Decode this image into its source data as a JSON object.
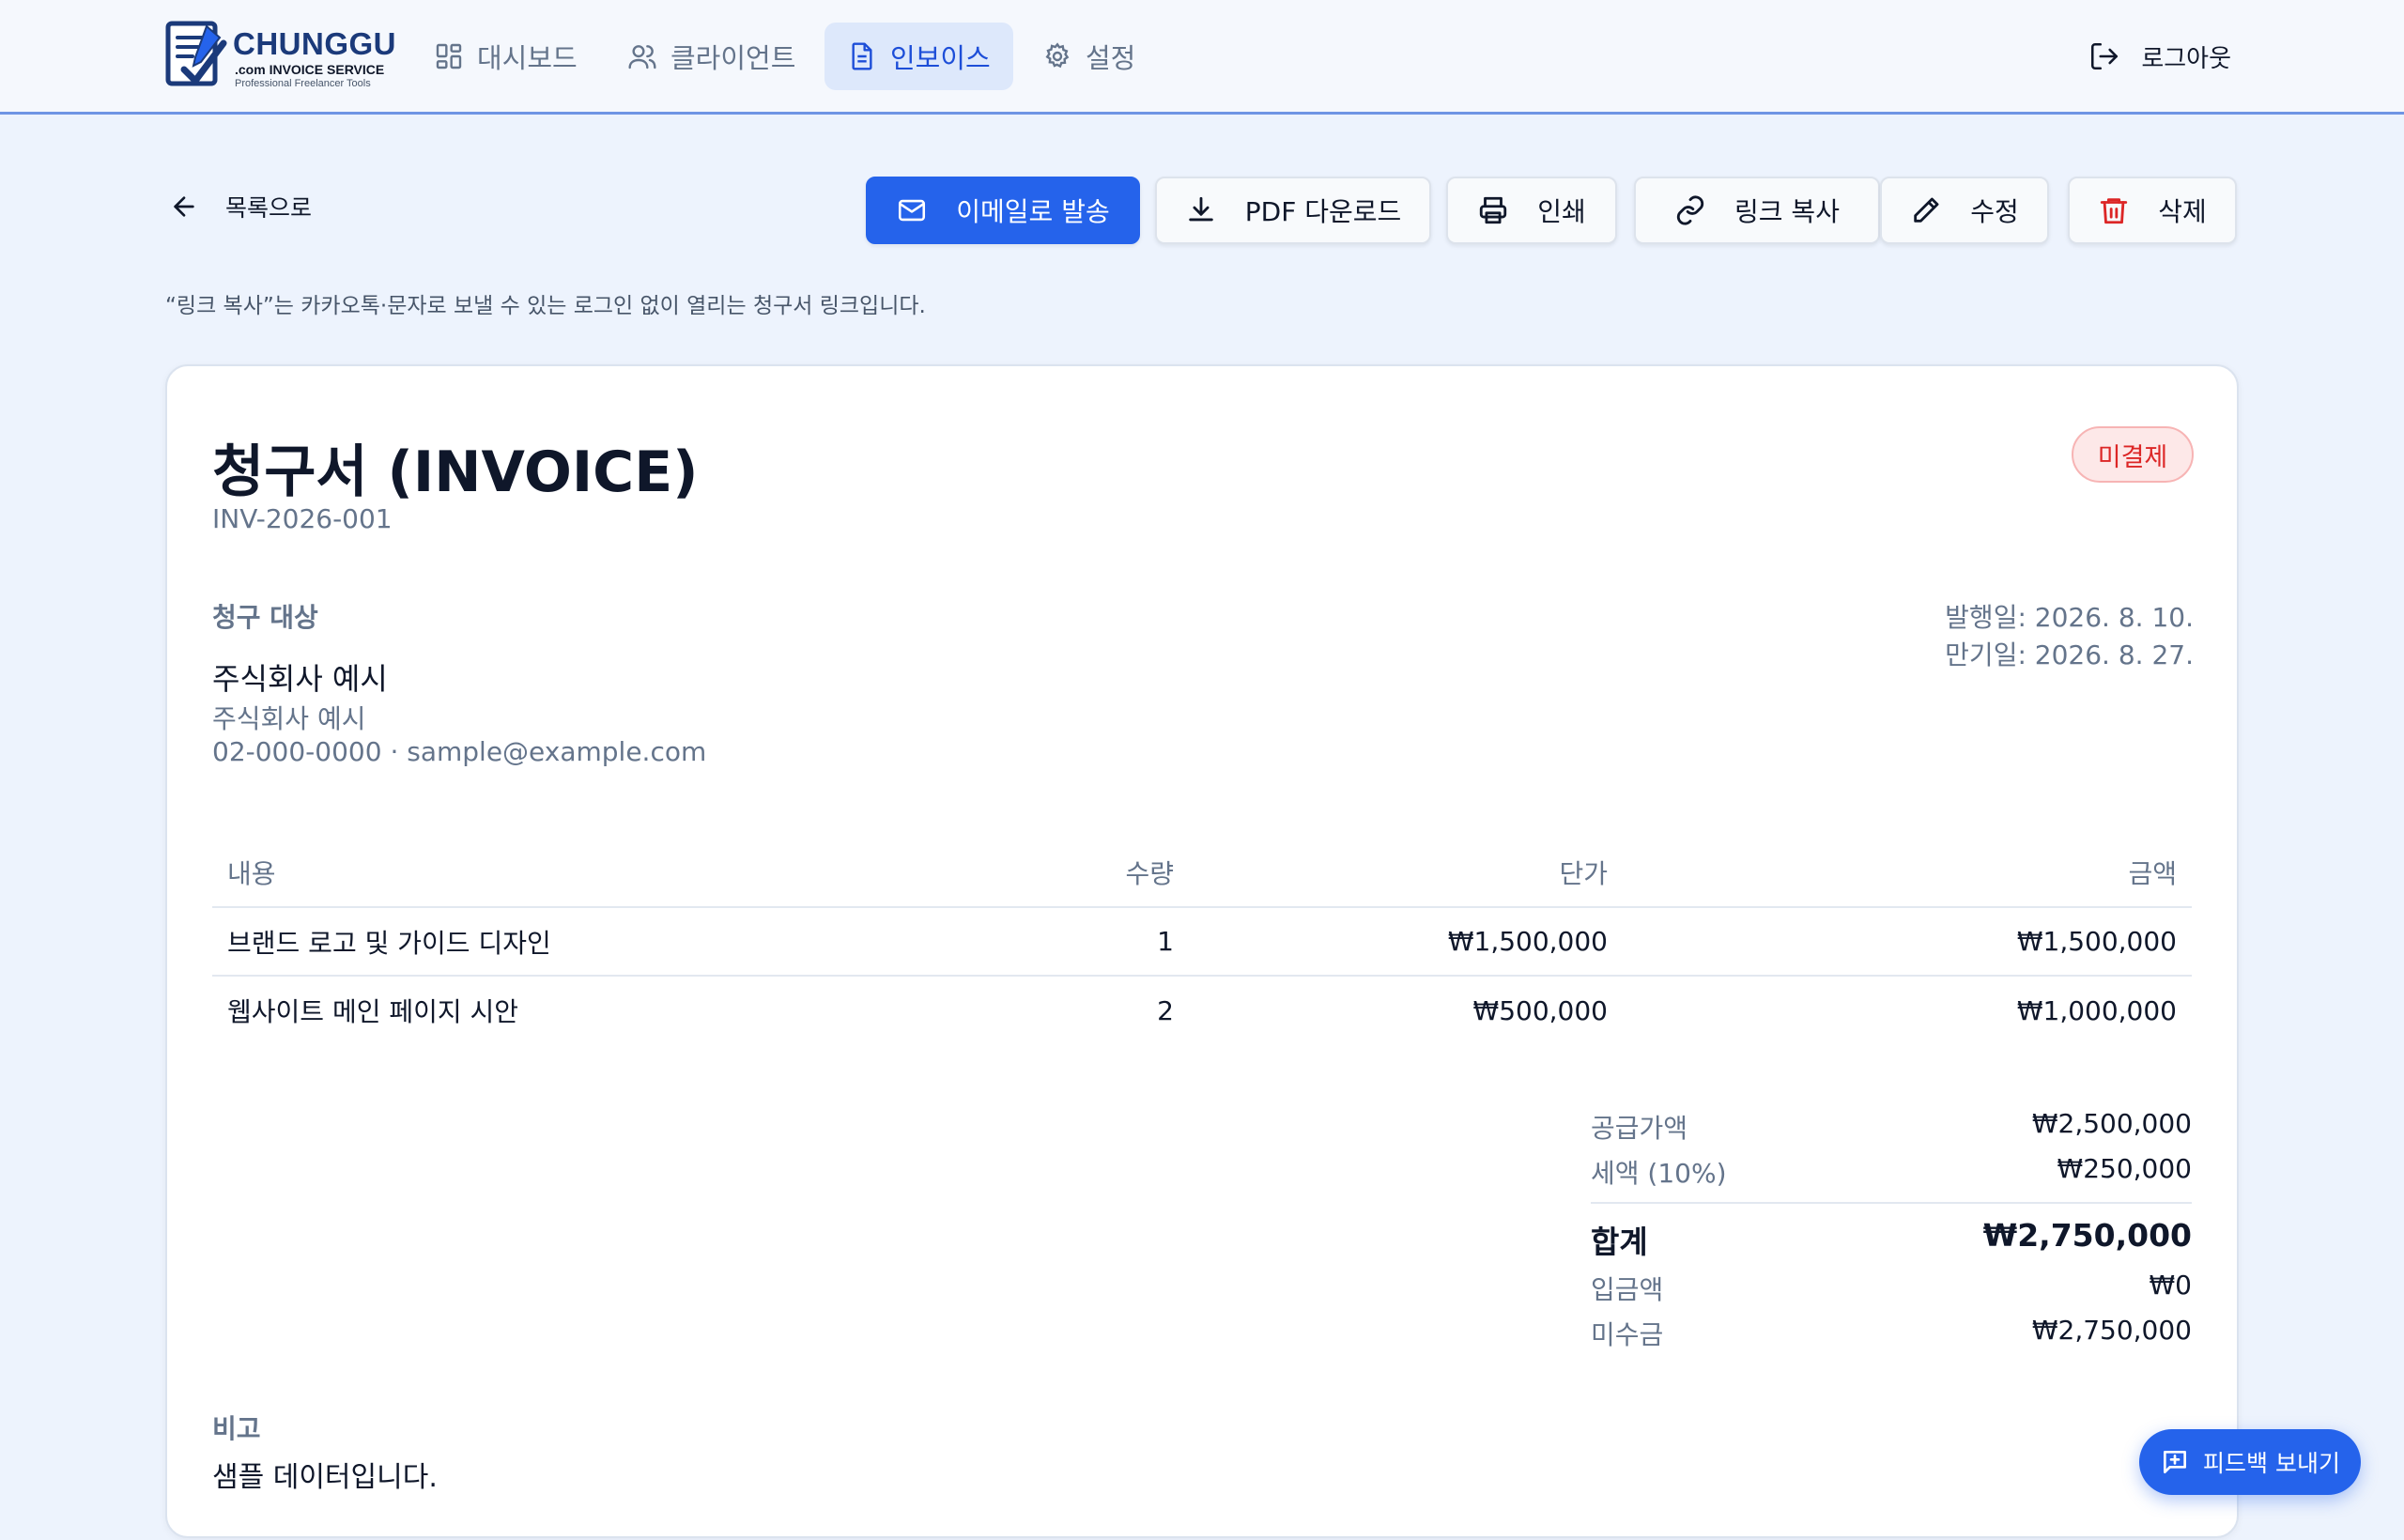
{
  "brand": {
    "title": "CHUNGGU",
    "subtitle": ".com INVOICE SERVICE",
    "tagline": "Professional Freelancer Tools"
  },
  "nav": {
    "dashboard": "대시보드",
    "clients": "클라이언트",
    "invoices": "인보이스",
    "settings": "설정",
    "logout": "로그아웃",
    "active": "invoices"
  },
  "toolbar": {
    "back": "목록으로",
    "email": "이메일로 발송",
    "pdf": "PDF 다운로드",
    "print": "인쇄",
    "copy_link": "링크 복사",
    "edit": "수정",
    "delete": "삭제"
  },
  "hint": "“링크 복사”는 카카오톡·문자로 보낼 수 있는 로그인 없이 열리는 청구서 링크입니다.",
  "invoice": {
    "title": "청구서 (INVOICE)",
    "number": "INV-2026-001",
    "status": "미결제",
    "bill_to_heading": "청구 대상",
    "client_name": "주식회사 예시",
    "client_company": "주식회사 예시",
    "client_contact": "02-000-0000 · sample@example.com",
    "issue_date": "발행일: 2026. 8. 10.",
    "due_date": "만기일: 2026. 8. 27.",
    "columns": {
      "description": "내용",
      "qty": "수량",
      "unit_price": "단가",
      "amount": "금액"
    },
    "items": [
      {
        "description": "브랜드 로고 및 가이드 디자인",
        "qty": "1",
        "unit_price": "₩1,500,000",
        "amount": "₩1,500,000"
      },
      {
        "description": "웹사이트 메인 페이지 시안",
        "qty": "2",
        "unit_price": "₩500,000",
        "amount": "₩1,000,000"
      }
    ],
    "totals": {
      "subtotal_label": "공급가액",
      "subtotal": "₩2,500,000",
      "tax_label": "세액 (10%)",
      "tax": "₩250,000",
      "total_label": "합계",
      "total": "₩2,750,000",
      "paid_label": "입금액",
      "paid": "₩0",
      "balance_label": "미수금",
      "balance": "₩2,750,000"
    },
    "notes_heading": "비고",
    "notes": "샘플 데이터입니다."
  },
  "feedback": {
    "label": "피드백 보내기"
  },
  "colors": {
    "accent": "#2563eb",
    "page_bg": "#edf3fd",
    "status_unpaid": "#dc2626",
    "delete_icon": "#dc2626"
  }
}
